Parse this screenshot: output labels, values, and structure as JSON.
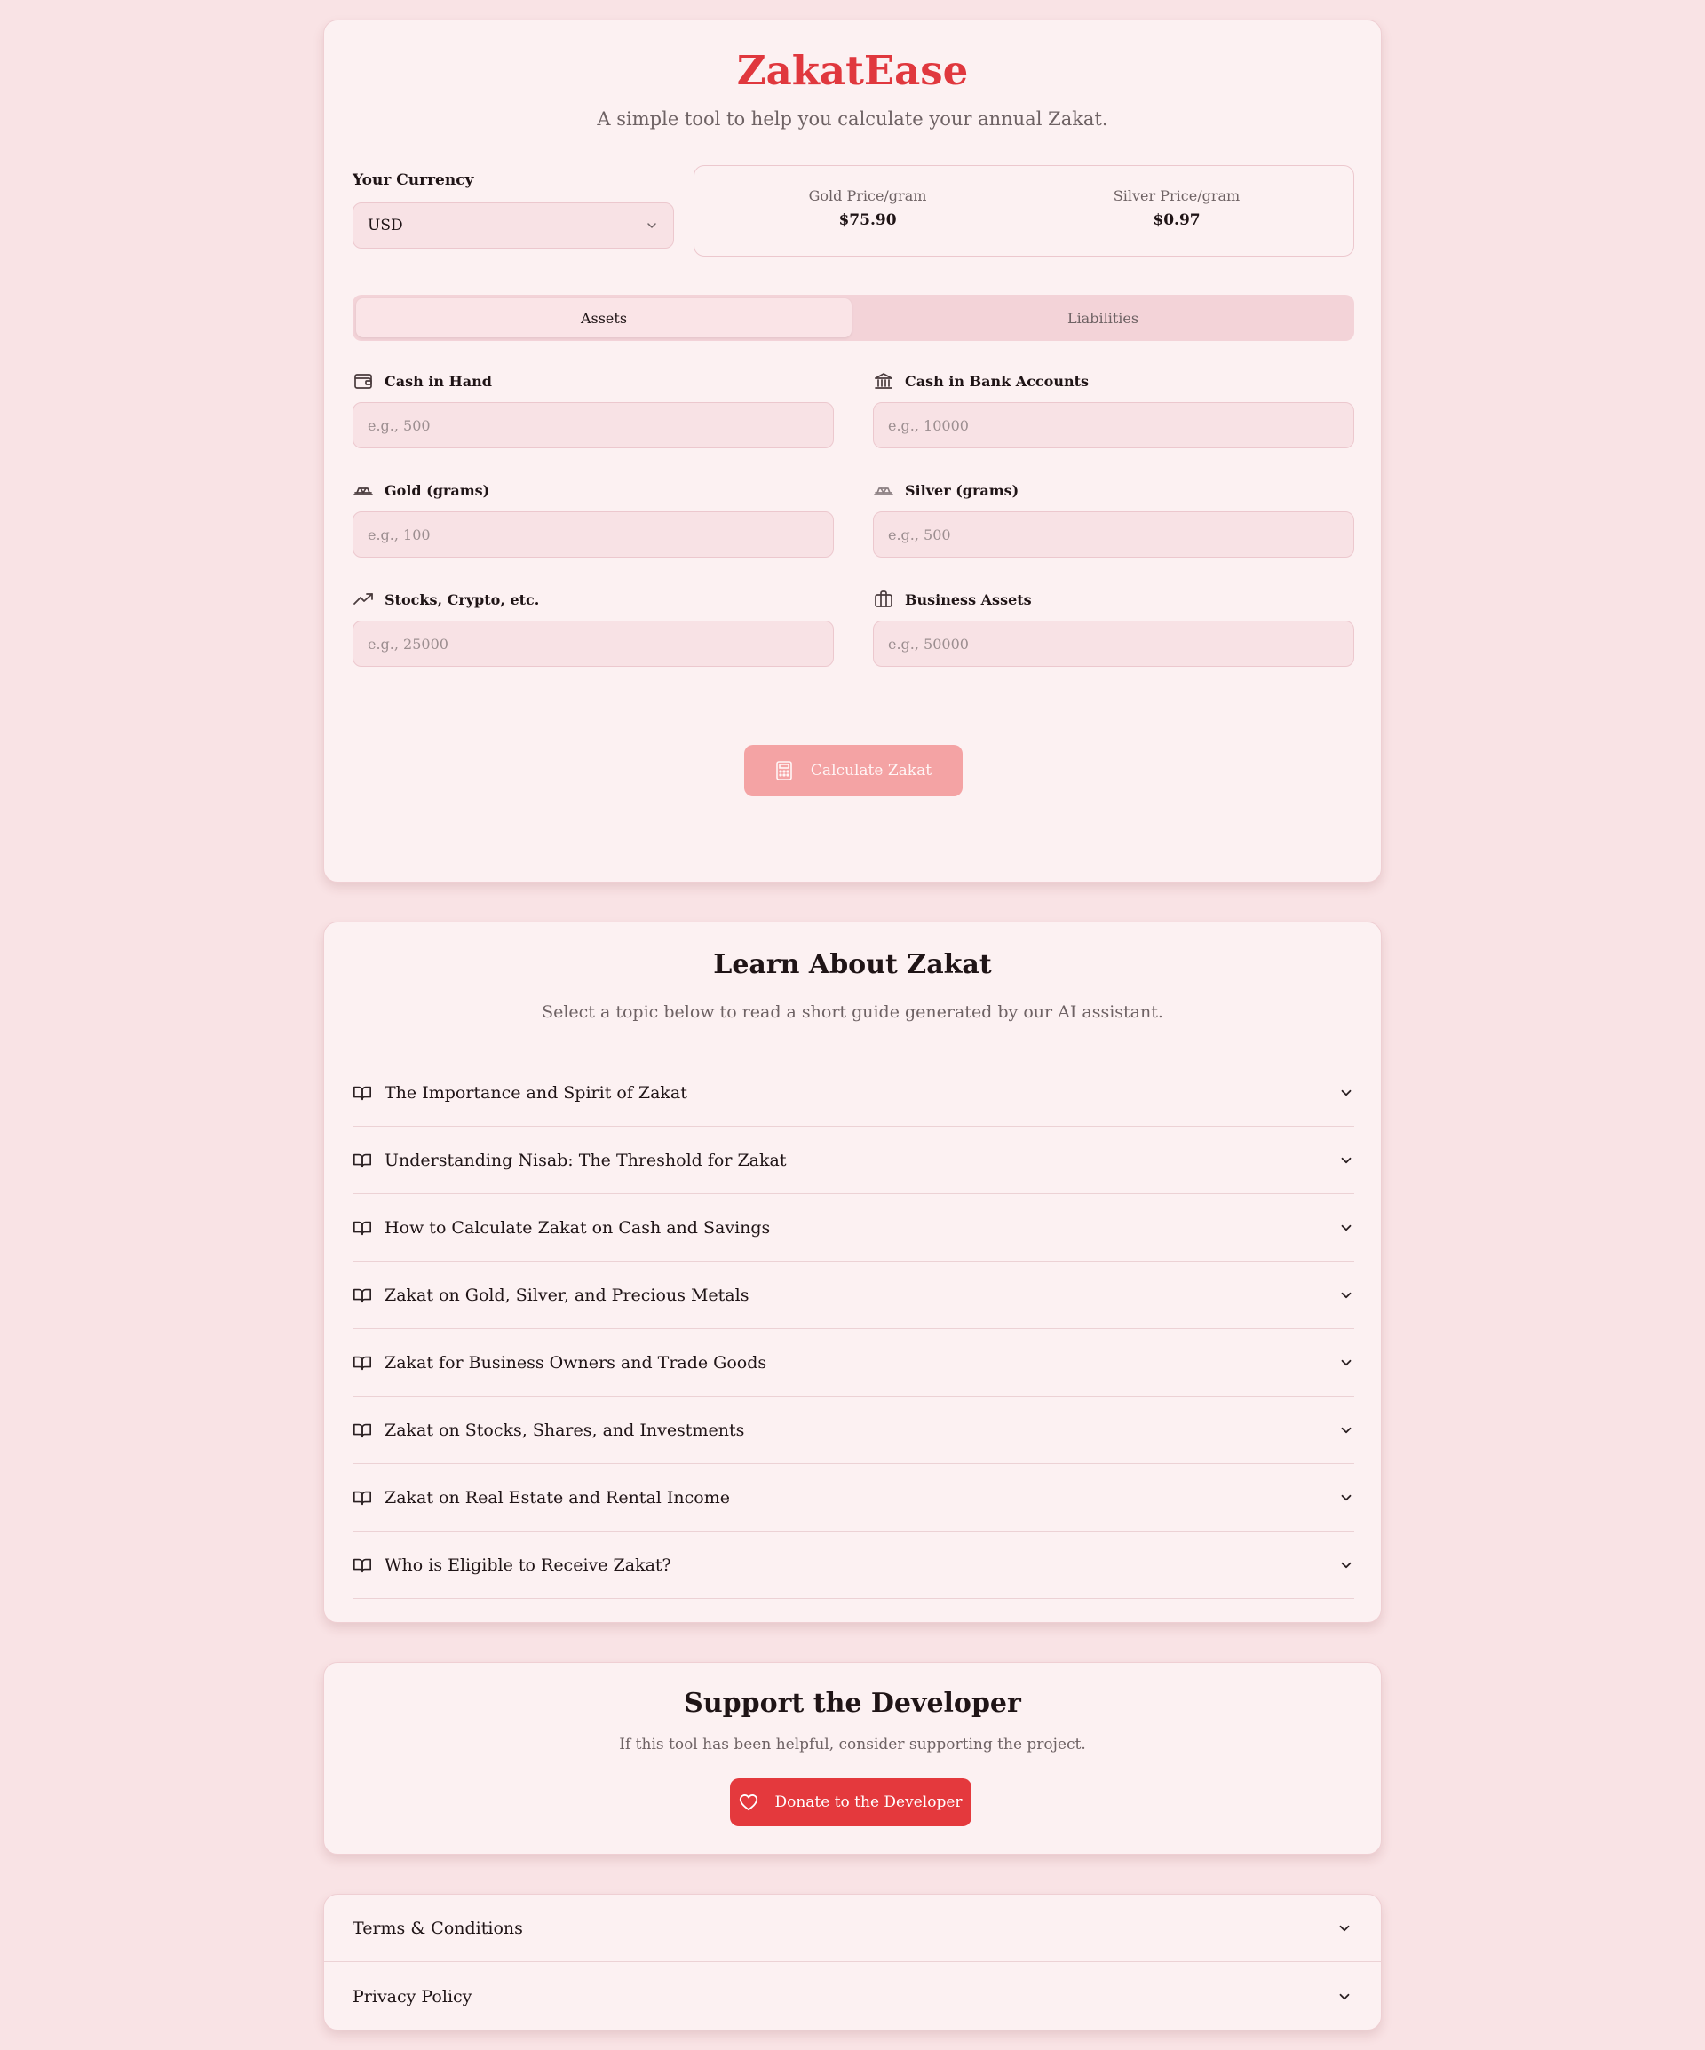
{
  "app": {
    "title": "ZakatEase",
    "subtitle": "A simple tool to help you calculate your annual Zakat."
  },
  "currency": {
    "label": "Your Currency",
    "value": "USD"
  },
  "prices": {
    "gold_label": "Gold Price/gram",
    "gold_value": "$75.90",
    "silver_label": "Silver Price/gram",
    "silver_value": "$0.97"
  },
  "tabs": {
    "assets": "Assets",
    "liabilities": "Liabilities",
    "active": "Assets"
  },
  "fields": [
    {
      "label": "Cash in Hand",
      "placeholder": "e.g., 500",
      "icon": "wallet-icon"
    },
    {
      "label": "Cash in Bank Accounts",
      "placeholder": "e.g., 10000",
      "icon": "bank-icon"
    },
    {
      "label": "Gold (grams)",
      "placeholder": "e.g., 100",
      "icon": "gem-icon"
    },
    {
      "label": "Silver (grams)",
      "placeholder": "e.g., 500",
      "icon": "gem-icon"
    },
    {
      "label": "Stocks, Crypto, etc.",
      "placeholder": "e.g., 25000",
      "icon": "trending-up-icon"
    },
    {
      "label": "Business Assets",
      "placeholder": "e.g., 50000",
      "icon": "briefcase-icon"
    }
  ],
  "calculate_button": "Calculate Zakat",
  "learn": {
    "title": "Learn About Zakat",
    "subtitle": "Select a topic below to read a short guide generated by our AI assistant.",
    "topics": [
      "The Importance and Spirit of Zakat",
      "Understanding Nisab: The Threshold for Zakat",
      "How to Calculate Zakat on Cash and Savings",
      "Zakat on Gold, Silver, and Precious Metals",
      "Zakat for Business Owners and Trade Goods",
      "Zakat on Stocks, Shares, and Investments",
      "Zakat on Real Estate and Rental Income",
      "Who is Eligible to Receive Zakat?"
    ]
  },
  "support": {
    "title": "Support the Developer",
    "subtitle": "If this tool has been helpful, consider supporting the project.",
    "button": "Donate to the Developer"
  },
  "legal": {
    "terms": "Terms & Conditions",
    "privacy": "Privacy Policy"
  },
  "colors": {
    "accent": "#e0383e",
    "background": "#f9e3e5",
    "card": "#fcf1f2"
  }
}
